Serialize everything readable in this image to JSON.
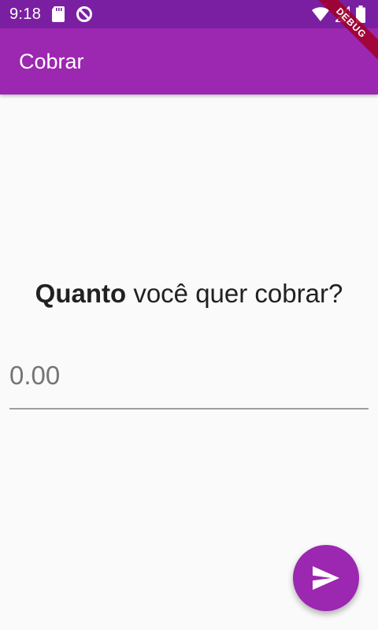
{
  "status_bar": {
    "time": "9:18",
    "left_icons": [
      "sd-card-icon",
      "data-saver-icon"
    ],
    "right_icons": [
      "wifi-icon",
      "cellular-signal-icon",
      "battery-icon"
    ],
    "background": "#7b1fa2"
  },
  "debug_banner": {
    "label": "DEBUG"
  },
  "app_bar": {
    "title": "Cobrar",
    "background": "#9c27b0"
  },
  "main": {
    "question_strong": "Quanto",
    "question_rest": "você quer cobrar?",
    "amount_placeholder": "0.00"
  },
  "fab": {
    "icon": "send-icon",
    "background": "#9c27b0"
  }
}
